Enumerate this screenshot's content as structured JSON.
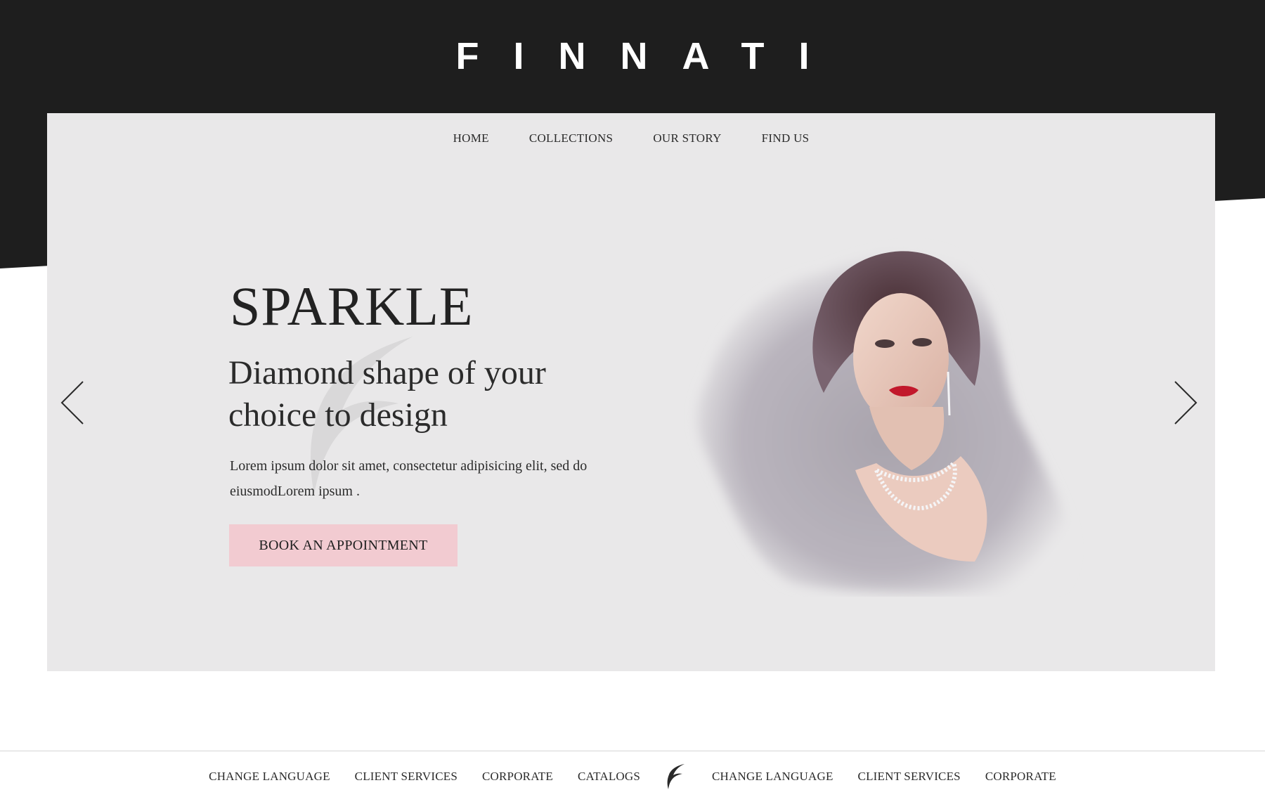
{
  "brand": {
    "name": "FINNATI"
  },
  "nav": {
    "items": [
      {
        "label": "HOME"
      },
      {
        "label": "COLLECTIONS"
      },
      {
        "label": "OUR STORY"
      },
      {
        "label": "FIND US"
      }
    ]
  },
  "hero": {
    "title": "SPARKLE",
    "subtitle": "Diamond shape of your choice to design",
    "body": "Lorem ipsum dolor sit amet, consectetur adipisicing elit, sed do eiusmodLorem ipsum .",
    "cta_label": "BOOK AN APPOINTMENT",
    "prev_icon": "chevron-left-icon",
    "next_icon": "chevron-right-icon",
    "image": "woman-wearing-diamond-necklace-and-fur"
  },
  "footer": {
    "left_items": [
      {
        "label": "CHANGE LANGUAGE"
      },
      {
        "label": "CLIENT SERVICES"
      },
      {
        "label": "CORPORATE"
      },
      {
        "label": "CATALOGS"
      }
    ],
    "logo_icon": "finnati-f-logo-icon",
    "right_items": [
      {
        "label": "CHANGE LANGUAGE"
      },
      {
        "label": "CLIENT SERVICES"
      },
      {
        "label": "CORPORATE"
      }
    ]
  },
  "colors": {
    "header_bg": "#1e1e1e",
    "hero_bg": "#e9e8e9",
    "cta_bg": "#f2cbd1",
    "lip_red": "#c2182b"
  }
}
